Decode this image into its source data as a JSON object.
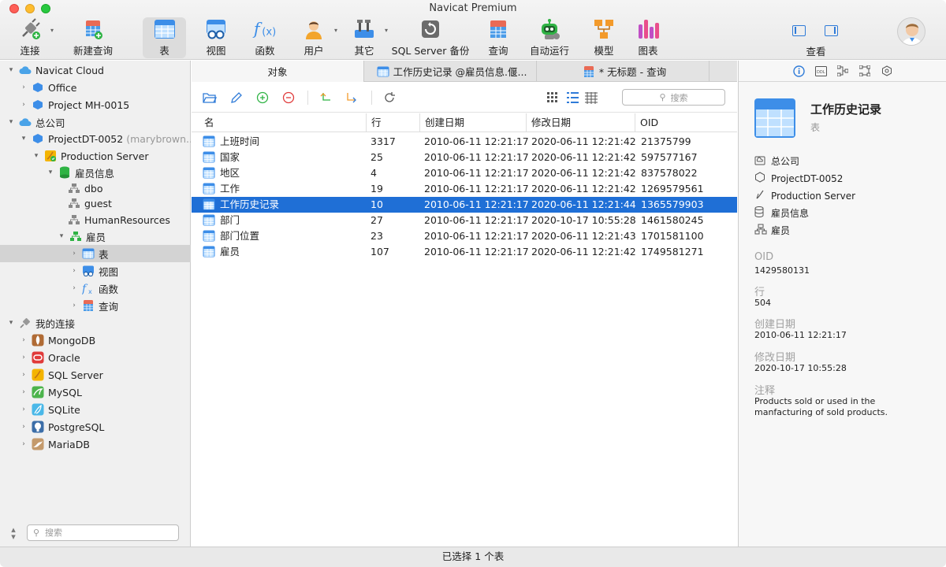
{
  "window": {
    "title": "Navicat Premium"
  },
  "toolbar": {
    "items": [
      {
        "label": "连接"
      },
      {
        "label": "新建查询"
      },
      {
        "label": "表"
      },
      {
        "label": "视图"
      },
      {
        "label": "函数"
      },
      {
        "label": "用户"
      },
      {
        "label": "其它"
      },
      {
        "label": "SQL Server 备份"
      },
      {
        "label": "查询"
      },
      {
        "label": "自动运行"
      },
      {
        "label": "模型"
      },
      {
        "label": "图表"
      }
    ],
    "view_label": "查看"
  },
  "sidebar": {
    "items": [
      {
        "label": "Navicat Cloud"
      },
      {
        "label": "Office"
      },
      {
        "label": "Project MH-0015"
      },
      {
        "label": "总公司"
      },
      {
        "label": "ProjectDT-0052",
        "suffix": "(marybrown..."
      },
      {
        "label": "Production Server"
      },
      {
        "label": "雇员信息"
      },
      {
        "label": "dbo"
      },
      {
        "label": "guest"
      },
      {
        "label": "HumanResources"
      },
      {
        "label": "雇员"
      },
      {
        "label": "表"
      },
      {
        "label": "视图"
      },
      {
        "label": "函数"
      },
      {
        "label": "查询"
      },
      {
        "label": "我的连接"
      },
      {
        "label": "MongoDB"
      },
      {
        "label": "Oracle"
      },
      {
        "label": "SQL Server"
      },
      {
        "label": "MySQL"
      },
      {
        "label": "SQLite"
      },
      {
        "label": "PostgreSQL"
      },
      {
        "label": "MariaDB"
      }
    ],
    "search_placeholder": "搜索"
  },
  "tabs": [
    {
      "label": "对象"
    },
    {
      "label": "工作历史记录 @雇员信息.偃..."
    },
    {
      "label": "* 无标题 - 查询"
    }
  ],
  "objbar": {
    "search_placeholder": "搜索"
  },
  "table": {
    "columns": [
      "名",
      "行",
      "创建日期",
      "修改日期",
      "OID"
    ],
    "rows": [
      {
        "name": "上班时间",
        "rows": "3317",
        "created": "2010-06-11 12:21:17",
        "modified": "2020-06-11 12:21:42",
        "oid": "21375799"
      },
      {
        "name": "国家",
        "rows": "25",
        "created": "2010-06-11 12:21:17",
        "modified": "2020-06-11 12:21:42",
        "oid": "597577167"
      },
      {
        "name": "地区",
        "rows": "4",
        "created": "2010-06-11 12:21:17",
        "modified": "2020-06-11 12:21:42",
        "oid": "837578022"
      },
      {
        "name": "工作",
        "rows": "19",
        "created": "2010-06-11 12:21:17",
        "modified": "2020-06-11 12:21:42",
        "oid": "1269579561"
      },
      {
        "name": "工作历史记录",
        "rows": "10",
        "created": "2010-06-11 12:21:17",
        "modified": "2020-06-11 12:21:44",
        "oid": "1365579903"
      },
      {
        "name": "部门",
        "rows": "27",
        "created": "2010-06-11 12:21:17",
        "modified": "2020-10-17 10:55:28",
        "oid": "1461580245"
      },
      {
        "name": "部门位置",
        "rows": "23",
        "created": "2010-06-11 12:21:17",
        "modified": "2020-06-11 12:21:43",
        "oid": "1701581100"
      },
      {
        "name": "雇员",
        "rows": "107",
        "created": "2010-06-11 12:21:17",
        "modified": "2020-06-11 12:21:42",
        "oid": "1749581271"
      }
    ]
  },
  "inspector": {
    "title": "工作历史记录",
    "subtitle": "表",
    "path": [
      "总公司",
      "ProjectDT-0052",
      "Production Server",
      "雇员信息",
      "雇员"
    ],
    "fields": [
      {
        "label": "OID",
        "value": "1429580131"
      },
      {
        "label": "行",
        "value": "504"
      },
      {
        "label": "创建日期",
        "value": "2010-06-11 12:21:17"
      },
      {
        "label": "修改日期",
        "value": "2020-10-17 10:55:28"
      },
      {
        "label": "注释",
        "value": "Products sold or used in the manfacturing of sold products."
      }
    ]
  },
  "status": {
    "text": "已选择 1 个表"
  },
  "colors": {
    "selection": "#1f6fd6",
    "table_icon": "#3d8ee8"
  }
}
